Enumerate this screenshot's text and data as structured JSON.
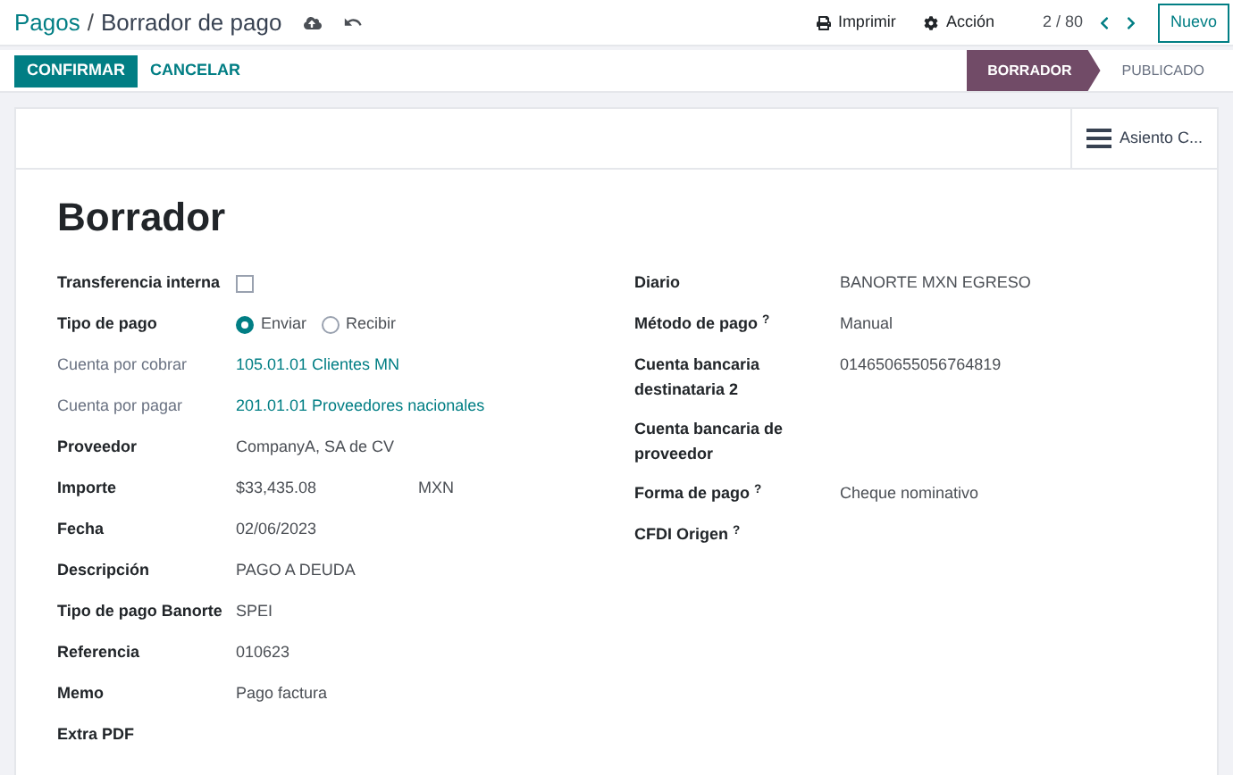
{
  "breadcrumb": {
    "parent": "Pagos",
    "separator": "/",
    "current": "Borrador de pago"
  },
  "top_actions": [
    "Imprimir",
    "Acción"
  ],
  "pager": "2 / 80",
  "new_button": "Nuevo",
  "buttons": [
    {
      "label": "CONFIRMAR",
      "primary": true
    },
    {
      "label": "CANCELAR",
      "primary": false
    }
  ],
  "status_steps": [
    {
      "label": "BORRADOR",
      "selected": true
    },
    {
      "label": "PUBLICADO",
      "selected": false
    }
  ],
  "smart_button": "Asiento C...",
  "title": "Borrador",
  "left_fields": [
    {
      "label": "Transferencia interna",
      "kind": "checkbox",
      "checked": false,
      "muted": false
    },
    {
      "label": "Tipo de pago",
      "kind": "radio",
      "muted": false,
      "options": [
        {
          "label": "Enviar",
          "selected": true
        },
        {
          "label": "Recibir",
          "selected": false
        }
      ]
    },
    {
      "label": "Cuenta por cobrar",
      "kind": "link",
      "value": "105.01.01 Clientes MN",
      "muted": true
    },
    {
      "label": "Cuenta por pagar",
      "kind": "link",
      "value": "201.01.01 Proveedores nacionales",
      "muted": true
    },
    {
      "label": "Proveedor",
      "kind": "text",
      "value": "CompanyA, SA de CV",
      "muted": false
    },
    {
      "label": "Importe",
      "kind": "amount",
      "value": "$33,435.08",
      "currency": "MXN",
      "muted": false
    },
    {
      "label": "Fecha",
      "kind": "text",
      "value": "02/06/2023",
      "muted": false
    },
    {
      "label": "Descripción",
      "kind": "text",
      "value": "PAGO A DEUDA",
      "muted": false
    },
    {
      "label": "Tipo de pago Banorte",
      "kind": "text",
      "value": "SPEI",
      "muted": false
    },
    {
      "label": "Referencia",
      "kind": "text",
      "value": "010623",
      "muted": false
    },
    {
      "label": "Memo",
      "kind": "text",
      "value": "Pago factura",
      "muted": false
    },
    {
      "label": "Extra PDF",
      "kind": "text",
      "muted": false
    }
  ],
  "right_fields": [
    {
      "label": "Diario",
      "value": "BANORTE MXN EGRESO"
    },
    {
      "label": "Método de pago $^{?}$",
      "value": "Manual"
    },
    {
      "label": "Cuenta bancaria destinataria 2",
      "value": "014650655056764819"
    },
    {
      "label": "Cuenta bancaria de proveedor"
    },
    {
      "label": "Forma de pago $^{?}$",
      "value": "Cheque nominativo"
    },
    {
      "label": "CFDI Origen $^{?}$"
    }
  ]
}
